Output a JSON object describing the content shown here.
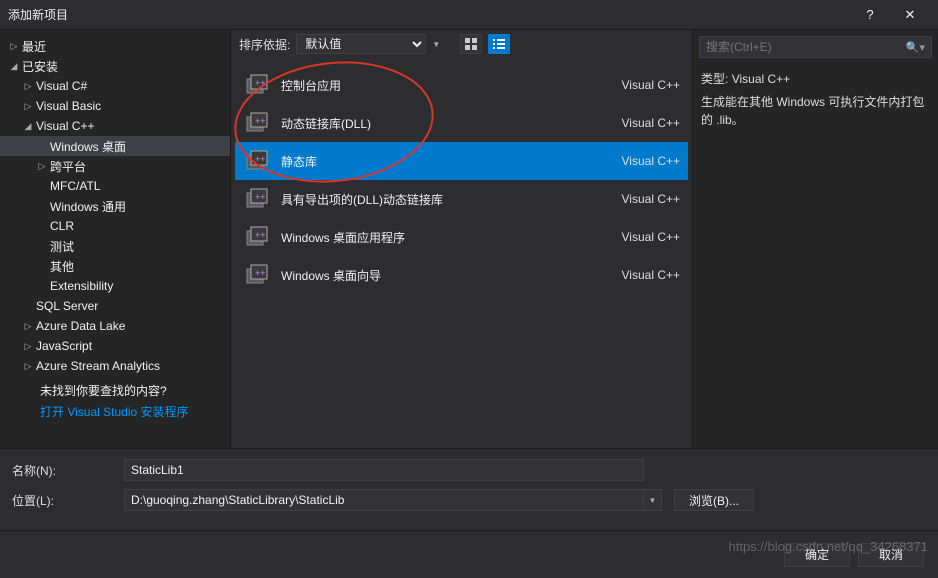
{
  "titlebar": {
    "title": "添加新项目",
    "help": "?",
    "close": "✕"
  },
  "sidebar": {
    "recent": "最近",
    "installed": "已安装",
    "nodes": [
      {
        "label": "Visual C#",
        "level": 1,
        "arrow": "▷"
      },
      {
        "label": "Visual Basic",
        "level": 1,
        "arrow": "▷"
      },
      {
        "label": "Visual C++",
        "level": 1,
        "arrow": "◢"
      },
      {
        "label": "Windows 桌面",
        "level": 2,
        "selected": true
      },
      {
        "label": "跨平台",
        "level": 2,
        "arrow": "▷"
      },
      {
        "label": "MFC/ATL",
        "level": 2
      },
      {
        "label": "Windows 通用",
        "level": 2
      },
      {
        "label": "CLR",
        "level": 2
      },
      {
        "label": "测试",
        "level": 2
      },
      {
        "label": "其他",
        "level": 2
      },
      {
        "label": "Extensibility",
        "level": 2
      },
      {
        "label": "SQL Server",
        "level": 1
      },
      {
        "label": "Azure Data Lake",
        "level": 1,
        "arrow": "▷"
      },
      {
        "label": "JavaScript",
        "level": 1,
        "arrow": "▷"
      },
      {
        "label": "Azure Stream Analytics",
        "level": 1,
        "arrow": "▷"
      }
    ],
    "help_text": "未找到你要查找的内容?",
    "link_text": "打开 Visual Studio 安装程序"
  },
  "center": {
    "sort_label": "排序依据:",
    "sort_value": "默认值",
    "templates": [
      {
        "name": "控制台应用",
        "lang": "Visual C++"
      },
      {
        "name": "动态链接库(DLL)",
        "lang": "Visual C++"
      },
      {
        "name": "静态库",
        "lang": "Visual C++",
        "selected": true
      },
      {
        "name": "具有导出项的(DLL)动态链接库",
        "lang": "Visual C++"
      },
      {
        "name": "Windows 桌面应用程序",
        "lang": "Visual C++"
      },
      {
        "name": "Windows 桌面向导",
        "lang": "Visual C++"
      }
    ]
  },
  "right": {
    "search_placeholder": "搜索(Ctrl+E)",
    "type_label": "类型:",
    "type_value": "Visual C++",
    "desc": "生成能在其他 Windows 可执行文件内打包的 .lib。"
  },
  "form": {
    "name_label": "名称(N):",
    "name_value": "StaticLib1",
    "loc_label": "位置(L):",
    "loc_value": "D:\\guoqing.zhang\\StaticLibrary\\StaticLib",
    "browse": "浏览(B)..."
  },
  "footer": {
    "ok": "确定",
    "cancel": "取消"
  },
  "watermark": "https://blog.csdn.net/qq_34268371"
}
